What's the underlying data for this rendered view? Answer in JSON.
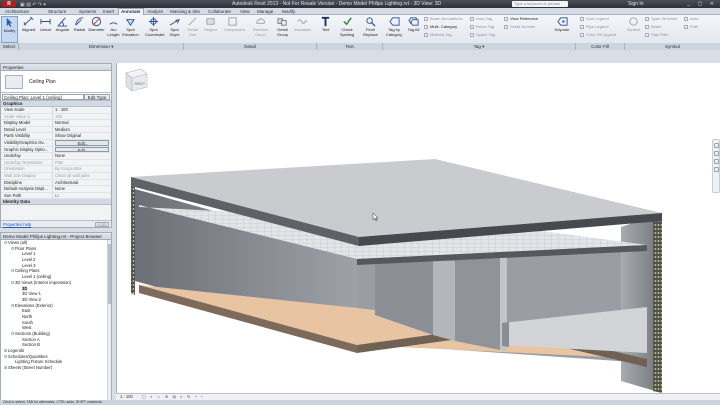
{
  "app": {
    "title": "Autodesk Revit 2013 -  Not For Resale Version -      Demo Model Philips Lighting.rvt - 3D View: 3D",
    "app_button": "R",
    "qat": "▣ ▤ ↶ ↷ ▾",
    "search_placeholder": "Type a keyword or phrase",
    "sign_in": "Sign In",
    "window_controls": "_ ▢ ✕"
  },
  "menu_tabs": [
    "Architecture",
    "Structure",
    "Systems",
    "Insert",
    "Annotate",
    "Analyze",
    "Massing & Site",
    "Collaborate",
    "View",
    "Manage",
    "Modify"
  ],
  "active_tab": "Annotate",
  "ribbon": {
    "modify": "Modify",
    "dimension_tools": [
      "Aligned",
      "Linear",
      "Angular",
      "Radial",
      "Diameter",
      "Arc Length",
      "Spot Elevation",
      "Spot Coordinate",
      "Spot Slope"
    ],
    "detail_tools": [
      "Detail Line",
      "Region",
      "Component",
      "Revision Cloud",
      "Detail Group",
      "Insulation"
    ],
    "text_tools": [
      "Text",
      "Check Spelling",
      "Find/ Replace"
    ],
    "tag_big": [
      "Tag by Category",
      "Tag All"
    ],
    "tag_small": [
      "Beam Annotations",
      "Multi- Category",
      "Material Tag",
      "Area Tag",
      "Room Tag",
      "Space Tag",
      "View Reference",
      "Detail Number",
      "Keynote"
    ],
    "color_fill": [
      "Duct Legend",
      "Pipe Legend",
      "Color Fill Legend"
    ],
    "symbol": [
      "Symbol",
      "Span Direction",
      "Beam",
      "Stair Path",
      "Area",
      "Path"
    ],
    "panels": [
      "Select",
      "Dimension ▾",
      "Detail",
      "Text",
      "Tag ▾",
      "Color Fill",
      "Symbol"
    ]
  },
  "properties": {
    "header": "Properties",
    "type_name": "Ceiling Plan",
    "instance_selector": "Ceiling Plan: Level 1 (ceiling)",
    "edit_type": "Edit Type",
    "group_graphics": "Graphics",
    "rows": [
      {
        "k": "View Scale",
        "v": "1 : 100",
        "dim": false
      },
      {
        "k": "Scale Value    1:",
        "v": "100",
        "dim": true
      },
      {
        "k": "Display Model",
        "v": "Normal",
        "dim": false
      },
      {
        "k": "Detail Level",
        "v": "Medium",
        "dim": false
      },
      {
        "k": "Parts Visibility",
        "v": "Show Original",
        "dim": false
      },
      {
        "k": "Visibility/Graphics Ov...",
        "v": "Edit...",
        "dim": false,
        "btn": true
      },
      {
        "k": "Graphic Display Optio...",
        "v": "Edit...",
        "dim": false,
        "btn": true
      },
      {
        "k": "Underlay",
        "v": "None",
        "dim": false
      },
      {
        "k": "Underlay Orientation",
        "v": "Plan",
        "dim": true
      },
      {
        "k": "Orientation",
        "v": "By Scope Box",
        "dim": true
      },
      {
        "k": "Wall Join Display",
        "v": "Clean all wall joins",
        "dim": true
      },
      {
        "k": "Discipline",
        "v": "Architectural",
        "dim": false
      },
      {
        "k": "Default Analysis Displ...",
        "v": "None",
        "dim": false
      },
      {
        "k": "Sun Path",
        "v": "☐",
        "dim": false
      }
    ],
    "group_identity": "Identity Data",
    "help_link": "Properties help",
    "apply": "Apply"
  },
  "browser": {
    "header": "Demo Model Philips Lighting.rvt - Project Browser",
    "nodes": [
      {
        "t": "Views (all)",
        "lvl": 0,
        "tg": "⊟"
      },
      {
        "t": "Floor Plans",
        "lvl": 1,
        "tg": "⊟"
      },
      {
        "t": "Level 1",
        "lvl": 2,
        "tg": ""
      },
      {
        "t": "Level 2",
        "lvl": 2,
        "tg": ""
      },
      {
        "t": "Level 3",
        "lvl": 2,
        "tg": ""
      },
      {
        "t": "Ceiling Plans",
        "lvl": 1,
        "tg": "⊟"
      },
      {
        "t": "Level 1 (ceiling)",
        "lvl": 2,
        "tg": ""
      },
      {
        "t": "3D Views (Interior impression)",
        "lvl": 1,
        "tg": "⊟"
      },
      {
        "t": "3D",
        "lvl": 2,
        "tg": "",
        "sel": true
      },
      {
        "t": "3D View 1",
        "lvl": 2,
        "tg": ""
      },
      {
        "t": "3D View 2",
        "lvl": 2,
        "tg": ""
      },
      {
        "t": "Elevations (Exterior)",
        "lvl": 1,
        "tg": "⊟"
      },
      {
        "t": "East",
        "lvl": 2,
        "tg": ""
      },
      {
        "t": "North",
        "lvl": 2,
        "tg": ""
      },
      {
        "t": "South",
        "lvl": 2,
        "tg": ""
      },
      {
        "t": "West",
        "lvl": 2,
        "tg": ""
      },
      {
        "t": "Sections (Building)",
        "lvl": 1,
        "tg": "⊟"
      },
      {
        "t": "Section A",
        "lvl": 2,
        "tg": ""
      },
      {
        "t": "Section B",
        "lvl": 2,
        "tg": ""
      },
      {
        "t": "Legends",
        "lvl": 0,
        "tg": "⊞"
      },
      {
        "t": "Schedules/Quantities",
        "lvl": 0,
        "tg": "⊟"
      },
      {
        "t": "Lighting Fixture Schedule",
        "lvl": 1,
        "tg": ""
      },
      {
        "t": "Sheets (Street Number)",
        "lvl": 0,
        "tg": "⊞"
      }
    ]
  },
  "viewport": {
    "viewcube_label": "RIGHT",
    "scale": "1 : 100",
    "view_icons": "▢ ◐ ☼ ⊕ ◍ ⌕ ⟲ ◔ ‹"
  },
  "status": "Click to select, TAB for alternates, CTRL adds, SHIFT unselects."
}
